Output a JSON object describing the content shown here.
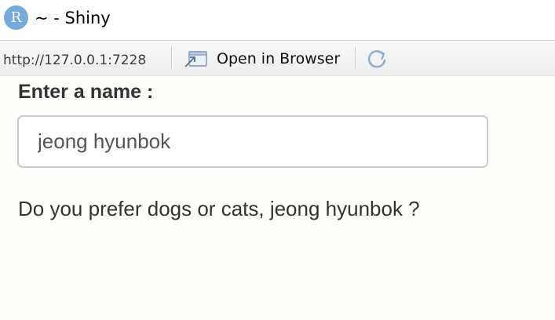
{
  "window": {
    "title": "~ - Shiny",
    "app_icon_letter": "R"
  },
  "toolbar": {
    "url": "http://127.0.0.1:7228",
    "open_in_browser_label": "Open in Browser",
    "open_in_browser_icon": "open-in-browser-icon",
    "refresh_icon": "refresh-icon"
  },
  "form": {
    "name_label": "Enter a name :",
    "name_value": "jeong hyunbok"
  },
  "output": {
    "message": "Do you prefer dogs or cats, jeong hyunbok ?"
  },
  "colors": {
    "app_icon_bg": "#75aadb",
    "page_bg": "#fffefb",
    "text": "#333333",
    "input_border": "#cccccc"
  }
}
